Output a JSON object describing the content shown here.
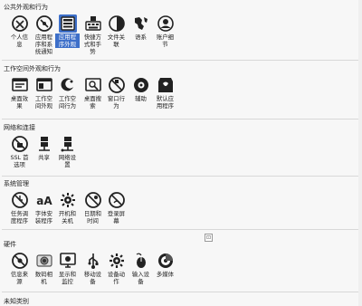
{
  "sections": [
    {
      "title": "公共外观和行为",
      "items": [
        {
          "label": "个人信息",
          "icon": "personal-info-icon"
        },
        {
          "label": "应用程序和系统通知",
          "icon": "notifications-icon"
        },
        {
          "label": "应用程序外观",
          "icon": "application-appearance-icon"
        },
        {
          "label": "快捷方式和手势",
          "icon": "shortcuts-icon"
        },
        {
          "label": "文件关联",
          "icon": "file-associations-icon"
        },
        {
          "label": "语系",
          "icon": "locale-icon"
        },
        {
          "label": "账户细节",
          "icon": "account-details-icon"
        }
      ]
    },
    {
      "title": "工作空间外观和行为",
      "items": [
        {
          "label": "桌面效果",
          "icon": "desktop-effects-icon"
        },
        {
          "label": "工作空间外观",
          "icon": "workspace-appearance-icon"
        },
        {
          "label": "工作空间行为",
          "icon": "workspace-behavior-icon"
        },
        {
          "label": "桌面搜索",
          "icon": "desktop-search-icon"
        },
        {
          "label": "窗口行为",
          "icon": "window-behavior-icon"
        },
        {
          "label": "辅助",
          "icon": "accessibility-icon"
        },
        {
          "label": "默认应用程序",
          "icon": "default-applications-icon"
        }
      ]
    },
    {
      "title": "网络和连接",
      "items": [
        {
          "label": "SSL 首选项",
          "icon": "ssl-icon"
        },
        {
          "label": "共享",
          "icon": "sharing-icon"
        },
        {
          "label": "网络设置",
          "icon": "network-settings-icon"
        }
      ]
    },
    {
      "title": "系统管理",
      "items": [
        {
          "label": "任务调度程序",
          "icon": "task-scheduler-icon"
        },
        {
          "label": "字体安装程序",
          "icon": "font-installer-icon"
        },
        {
          "label": "开机和关机",
          "icon": "startup-shutdown-icon"
        },
        {
          "label": "日期和时间",
          "icon": "date-time-icon"
        },
        {
          "label": "登录屏幕",
          "icon": "login-screen-icon"
        }
      ]
    },
    {
      "title": "硬件",
      "items": [
        {
          "label": "信息来源",
          "icon": "information-sources-icon"
        },
        {
          "label": "数码相机",
          "icon": "digital-camera-icon"
        },
        {
          "label": "显示和监控",
          "icon": "display-monitor-icon"
        },
        {
          "label": "移动设备",
          "icon": "removable-devices-icon"
        },
        {
          "label": "设备动作",
          "icon": "device-actions-icon"
        },
        {
          "label": "输入设备",
          "icon": "input-devices-icon"
        },
        {
          "label": "多媒体",
          "icon": "multimedia-icon"
        }
      ]
    },
    {
      "title": "未知类别",
      "items": []
    }
  ],
  "selected": "应用程序外观",
  "resize_glyph": "⊡",
  "colors": {
    "selection": "#3d6fc9",
    "background": "#f7f7f7"
  }
}
